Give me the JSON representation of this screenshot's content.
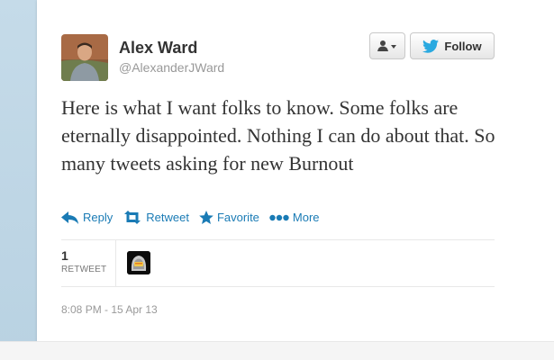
{
  "tweet": {
    "author_name": "Alex Ward",
    "author_handle": "@AlexanderJWard",
    "text": "Here is what I want folks to know. Some folks are eternally disappointed. Nothing I can do about that. So many tweets asking for new Burnout",
    "timestamp": "8:08 PM - 15 Apr 13"
  },
  "buttons": {
    "follow_label": "Follow",
    "user_menu_icon": "user-dropdown-icon"
  },
  "actions": [
    {
      "label": "Reply",
      "icon": "reply-icon"
    },
    {
      "label": "Retweet",
      "icon": "retweet-icon"
    },
    {
      "label": "Favorite",
      "icon": "star-icon"
    },
    {
      "label": "More",
      "icon": "more-icon"
    }
  ],
  "stats": {
    "retweet_count": "1",
    "retweet_label": "RETWEET"
  },
  "colors": {
    "link": "#1a7bb5",
    "twitter_blue": "#2aa9e0",
    "text": "#333333",
    "muted": "#999999"
  }
}
